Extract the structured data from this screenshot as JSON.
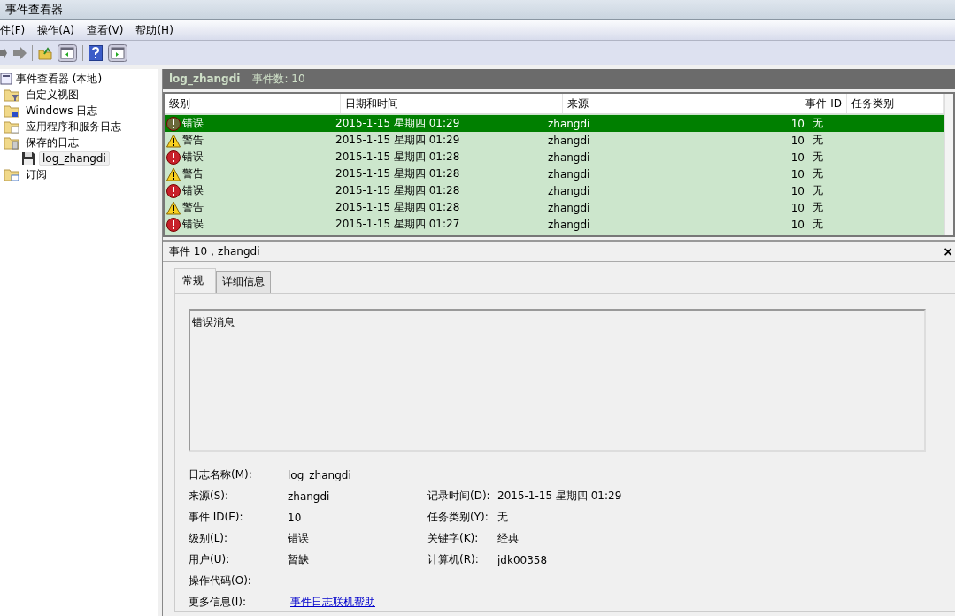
{
  "window": {
    "title": "事件查看器"
  },
  "menu": [
    "件(F)",
    "操作(A)",
    "查看(V)",
    "帮助(H)"
  ],
  "tree": {
    "label": "事件查看器 (本地)",
    "children": [
      {
        "label": "自定义视图",
        "kind": "filter",
        "selected": false
      },
      {
        "label": "Windows 日志",
        "kind": "windows",
        "selected": false
      },
      {
        "label": "应用程序和服务日志",
        "kind": "folder",
        "selected": false
      },
      {
        "label": "保存的日志",
        "kind": "saved",
        "selected": false,
        "children": [
          {
            "label": "log_zhangdi",
            "selected": true
          }
        ]
      },
      {
        "label": "订阅",
        "kind": "subscription",
        "selected": false
      }
    ]
  },
  "log_header": {
    "name": "log_zhangdi",
    "count": "事件数: 10"
  },
  "table": {
    "columns": [
      "级别",
      "日期和时间",
      "来源",
      "事件 ID",
      "任务类别"
    ],
    "rows": [
      {
        "kind": "error",
        "level": "错误",
        "date": "2015-1-15 星期四 01:29",
        "source": "zhangdi",
        "id": "10",
        "task": "无",
        "selected": true
      },
      {
        "kind": "warning",
        "level": "警告",
        "date": "2015-1-15 星期四 01:29",
        "source": "zhangdi",
        "id": "10",
        "task": "无",
        "selected": false
      },
      {
        "kind": "error",
        "level": "错误",
        "date": "2015-1-15 星期四 01:28",
        "source": "zhangdi",
        "id": "10",
        "task": "无",
        "selected": false
      },
      {
        "kind": "warning",
        "level": "警告",
        "date": "2015-1-15 星期四 01:28",
        "source": "zhangdi",
        "id": "10",
        "task": "无",
        "selected": false
      },
      {
        "kind": "error",
        "level": "错误",
        "date": "2015-1-15 星期四 01:28",
        "source": "zhangdi",
        "id": "10",
        "task": "无",
        "selected": false
      },
      {
        "kind": "warning",
        "level": "警告",
        "date": "2015-1-15 星期四 01:28",
        "source": "zhangdi",
        "id": "10",
        "task": "无",
        "selected": false
      },
      {
        "kind": "error",
        "level": "错误",
        "date": "2015-1-15 星期四 01:27",
        "source": "zhangdi",
        "id": "10",
        "task": "无",
        "selected": false
      }
    ]
  },
  "detail": {
    "title": "事件 10，zhangdi",
    "close": "×",
    "tabs": [
      {
        "label": "常规",
        "selected": true
      },
      {
        "label": "详细信息",
        "selected": false
      }
    ],
    "message": "错误消息",
    "fields": [
      {
        "label": "日志名称(M):",
        "value": "log_zhangdi"
      },
      {
        "label": "来源(S):",
        "value": "zhangdi",
        "label2": "记录时间(D):",
        "value2": "2015-1-15 星期四 01:29"
      },
      {
        "label": "事件 ID(E):",
        "value": "10",
        "label2": "任务类别(Y):",
        "value2": "无"
      },
      {
        "label": "级别(L):",
        "value": "错误",
        "label2": "关键字(K):",
        "value2": "经典"
      },
      {
        "label": "用户(U):",
        "value": "暂缺",
        "label2": "计算机(R):",
        "value2": "jdk00358"
      },
      {
        "label": "操作代码(O):"
      },
      {
        "label": "更多信息(I):",
        "link": "事件日志联机帮助"
      }
    ]
  }
}
